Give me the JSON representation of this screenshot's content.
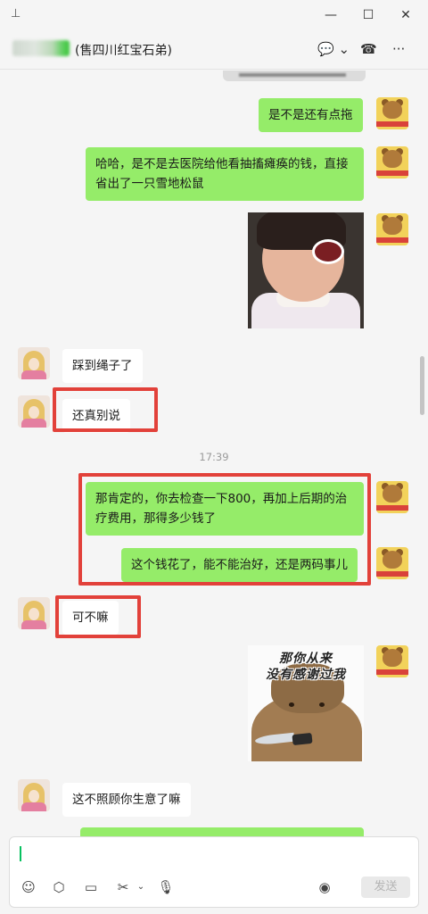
{
  "window": {
    "pin": "⊥",
    "minimize": "—",
    "maximize": "☐",
    "close": "✕"
  },
  "header": {
    "title": "(售四川红宝石弟)",
    "chat_icon": "💬 ⌄",
    "call_icon": "☎",
    "more_icon": "···"
  },
  "messages": [
    {
      "from": "me",
      "text": "是不是还有点拖"
    },
    {
      "from": "me",
      "text": "哈哈，是不是去医院给他看抽搐瘫痪的钱，直接省出了一只雪地松鼠"
    },
    {
      "from": "me",
      "type": "image",
      "desc": "laughing-girl-sticker"
    },
    {
      "from": "other",
      "text": "踩到绳子了"
    },
    {
      "from": "other",
      "text": "还真别说"
    },
    {
      "type": "time",
      "text": "17:39"
    },
    {
      "from": "me",
      "text": "那肯定的，你去检查一下800，再加上后期的治疗费用，那得多少钱了"
    },
    {
      "from": "me",
      "text": "这个钱花了，能不能治好，还是两码事儿"
    },
    {
      "from": "other",
      "text": "可不嘛"
    },
    {
      "from": "me",
      "type": "image",
      "caption_line1": "那你从来",
      "caption_line2": "没有感谢过我"
    },
    {
      "from": "other",
      "text": "这不照顾你生意了嘛"
    }
  ],
  "composer": {
    "send_label": "发送"
  },
  "colors": {
    "my_bubble": "#95ec69",
    "other_bubble": "#ffffff",
    "highlight_box": "#e2413a",
    "send_disabled": "#e9e9e9"
  }
}
